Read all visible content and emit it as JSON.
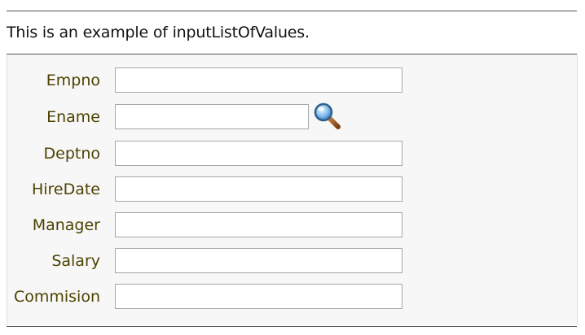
{
  "header": {
    "text": "This is an example of inputListOfValues."
  },
  "form": {
    "fields": [
      {
        "label": "Empno",
        "value": ""
      },
      {
        "label": "Ename",
        "value": ""
      },
      {
        "label": "Deptno",
        "value": ""
      },
      {
        "label": "HireDate",
        "value": ""
      },
      {
        "label": "Manager",
        "value": ""
      },
      {
        "label": "Salary",
        "value": ""
      },
      {
        "label": "Commision",
        "value": ""
      }
    ],
    "lov_search_icon": "magnifier-icon"
  },
  "colors": {
    "label_text": "#4d4200",
    "panel_bg": "#f7f7f7",
    "input_border": "#a7a7a7",
    "rule": "#555555"
  }
}
